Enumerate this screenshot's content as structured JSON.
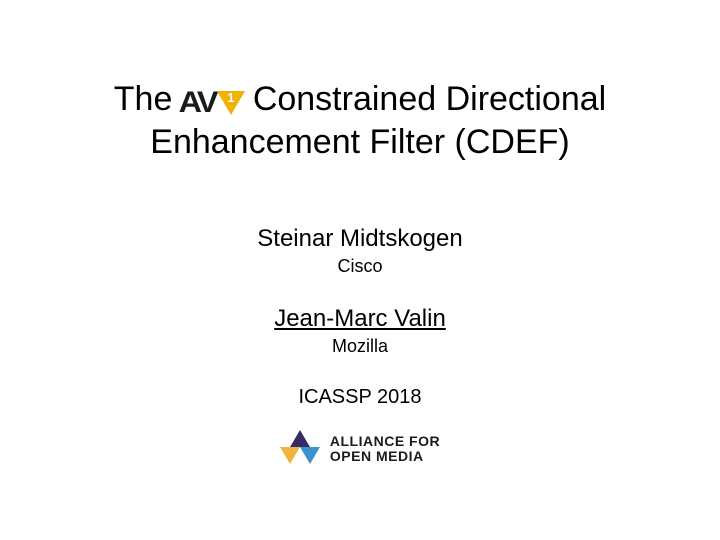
{
  "title": {
    "prefix": "The",
    "rest_line1": "Constrained Directional",
    "line2": "Enhancement Filter (CDEF)"
  },
  "av1_logo": {
    "letters": "AV",
    "digit": "1"
  },
  "authors": [
    {
      "name": "Steinar Midtskogen",
      "affiliation": "Cisco",
      "is_speaker": false
    },
    {
      "name": "Jean-Marc Valin",
      "affiliation": "Mozilla",
      "is_speaker": true
    }
  ],
  "venue": "ICASSP 2018",
  "aomedia": {
    "line1": "ALLIANCE FOR",
    "line2": "OPEN MEDIA"
  }
}
